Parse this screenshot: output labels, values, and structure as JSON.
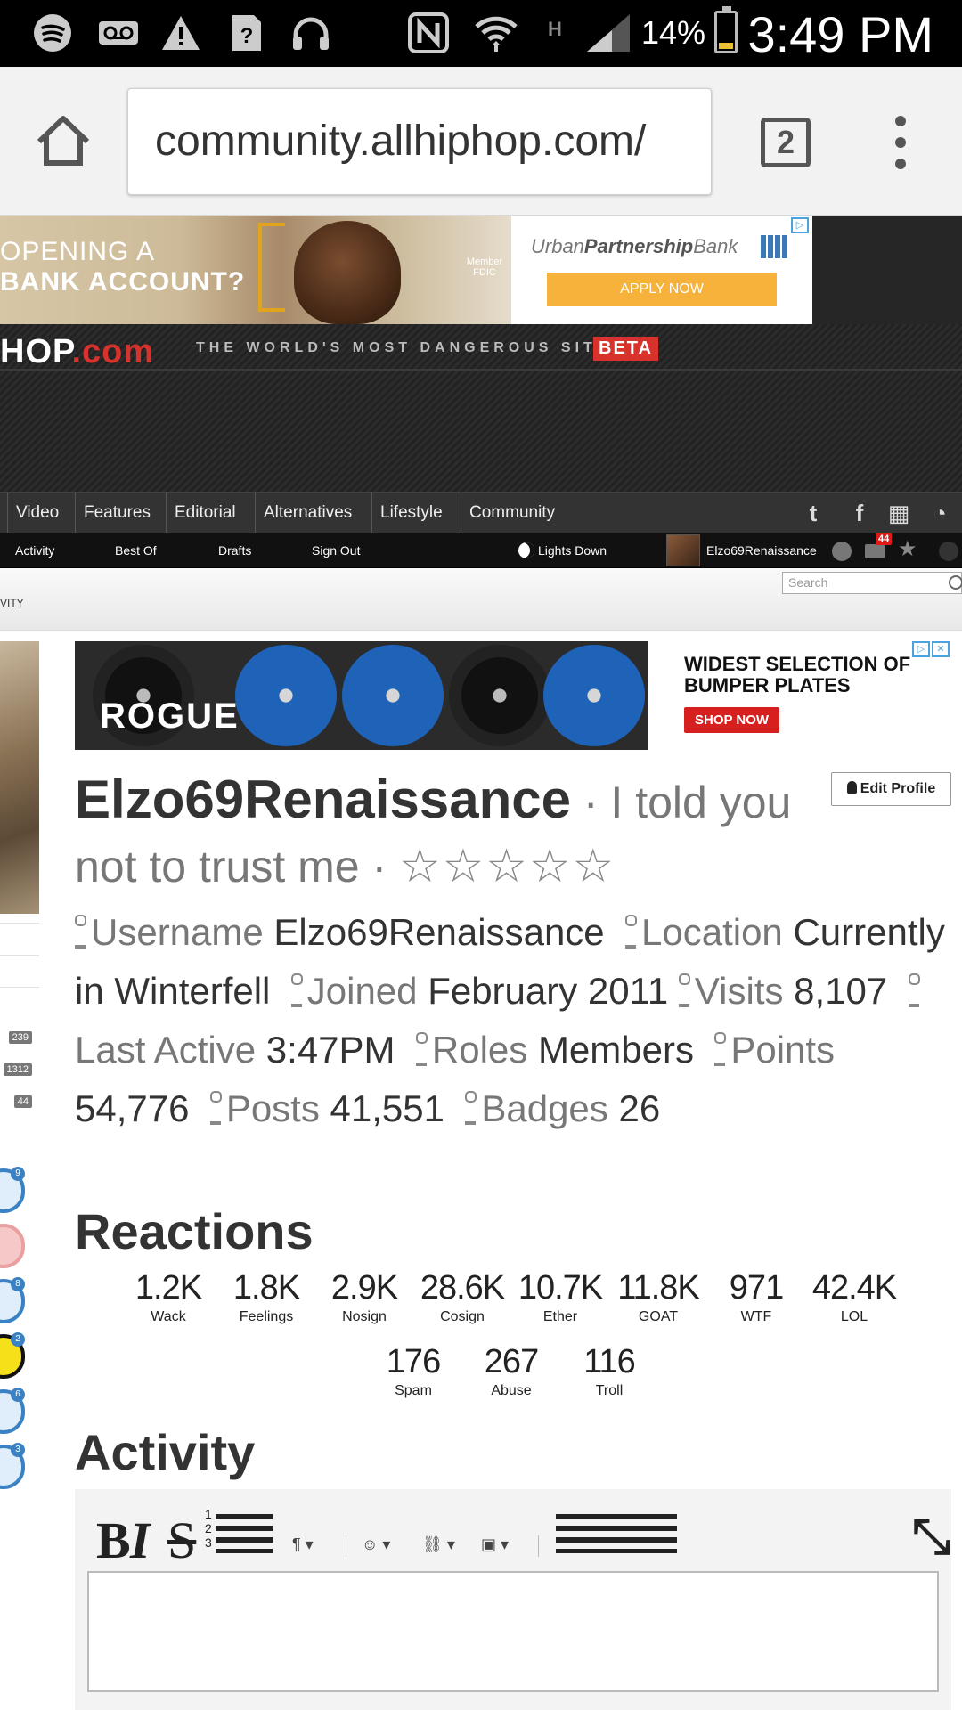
{
  "status_bar": {
    "battery_pct": "14%",
    "time": "3:49 PM",
    "icons": [
      "spotify-icon",
      "voicemail-icon",
      "warning-icon",
      "unknown-sim-icon",
      "headphones-icon",
      "nfc-icon",
      "wifi-icon",
      "signal-icon",
      "battery-icon"
    ]
  },
  "browser": {
    "url": "community.allhiphop.com/",
    "tab_count": "2"
  },
  "top_ad": {
    "headline_1": "OPENING A",
    "headline_2": "BANK ACCOUNT?",
    "fdic": "Member FDIC",
    "brand_plain": "Urban",
    "brand_bold": "Partnership",
    "brand_tail": "Bank",
    "cta": "APPLY NOW"
  },
  "site": {
    "logo_white": "HOP",
    "logo_red": ".com",
    "tagline": "THE WORLD'S MOST DANGEROUS SITE",
    "beta": "BETA"
  },
  "main_nav": [
    "Video",
    "Features",
    "Editorial",
    "Alternatives",
    "Lifestyle",
    "Community"
  ],
  "sub_nav": {
    "items": [
      "Activity",
      "Best Of",
      "Drafts",
      "Sign Out"
    ],
    "lights": "Lights Down",
    "username": "Elzo69Renaissance",
    "mail_count": "44"
  },
  "crumb": "VITY",
  "search_placeholder": "Search",
  "sidebar": {
    "counts": [
      "239",
      "1312",
      "44"
    ],
    "badge_numbers": [
      "9",
      "",
      "8",
      "2",
      "6",
      "3"
    ]
  },
  "rogue_ad": {
    "logo": "ROGUE",
    "line1": "WIDEST SELECTION OF",
    "line2": "BUMPER PLATES",
    "cta": "SHOP NOW"
  },
  "profile": {
    "edit_label": "Edit Profile",
    "name": "Elzo69Renaissance",
    "tagline": "I told you not to trust me",
    "rating_stars": 5,
    "username_label": "Username",
    "username": "Elzo69Renaissance",
    "location_label": "Location",
    "location": "Currently in Winterfell",
    "joined_label": "Joined",
    "joined": "February 2011",
    "visits_label": "Visits",
    "visits": "8,107",
    "last_active_label": "Last Active",
    "last_active": "3:47PM",
    "roles_label": "Roles",
    "roles": "Members",
    "points_label": "Points",
    "points": "54,776",
    "posts_label": "Posts",
    "posts": "41,551",
    "badges_label": "Badges",
    "badges": "26"
  },
  "reactions_title": "Reactions",
  "reactions": [
    {
      "count": "1.2K",
      "name": "Wack"
    },
    {
      "count": "1.8K",
      "name": "Feelings"
    },
    {
      "count": "2.9K",
      "name": "Nosign"
    },
    {
      "count": "28.6K",
      "name": "Cosign"
    },
    {
      "count": "10.7K",
      "name": "Ether"
    },
    {
      "count": "11.8K",
      "name": "GOAT"
    },
    {
      "count": "971",
      "name": "WTF"
    },
    {
      "count": "42.4K",
      "name": "LOL"
    },
    {
      "count": "176",
      "name": "Spam"
    },
    {
      "count": "267",
      "name": "Abuse"
    },
    {
      "count": "116",
      "name": "Troll"
    }
  ],
  "activity_title": "Activity",
  "editor": {
    "bold": "B",
    "italic": "I",
    "strike": "S",
    "list_numbers": "1 2 3"
  }
}
